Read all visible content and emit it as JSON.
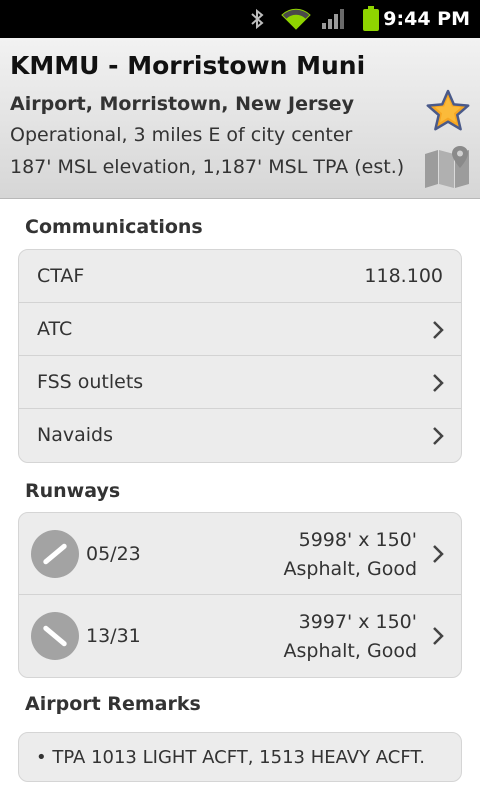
{
  "status_bar": {
    "time": "9:44 PM",
    "icons": [
      "bluetooth-icon",
      "wifi-icon",
      "signal-icon",
      "battery-icon"
    ],
    "battery_color": "#8fd400"
  },
  "header": {
    "title": "KMMU - Morristown Muni",
    "subtitle": "Airport, Morristown, New Jersey",
    "status": "Operational, 3 miles E of city center",
    "elevation": "187' MSL elevation, 1,187' MSL TPA (est.)",
    "favorite_icon": "star-icon",
    "map_icon": "map-icon"
  },
  "communications": {
    "title": "Communications",
    "items": [
      {
        "label": "CTAF",
        "value": "118.100"
      },
      {
        "label": "ATC"
      },
      {
        "label": "FSS outlets"
      },
      {
        "label": "Navaids"
      }
    ]
  },
  "runways": {
    "title": "Runways",
    "items": [
      {
        "id": "05/23",
        "size": "5998' x 150'",
        "surface": "Asphalt, Good",
        "heading_deg": 50
      },
      {
        "id": "13/31",
        "size": "3997' x 150'",
        "surface": "Asphalt, Good",
        "heading_deg": 130
      }
    ]
  },
  "remarks": {
    "title": "Airport Remarks",
    "items": [
      "• TPA 1013 LIGHT ACFT, 1513 HEAVY ACFT."
    ]
  }
}
